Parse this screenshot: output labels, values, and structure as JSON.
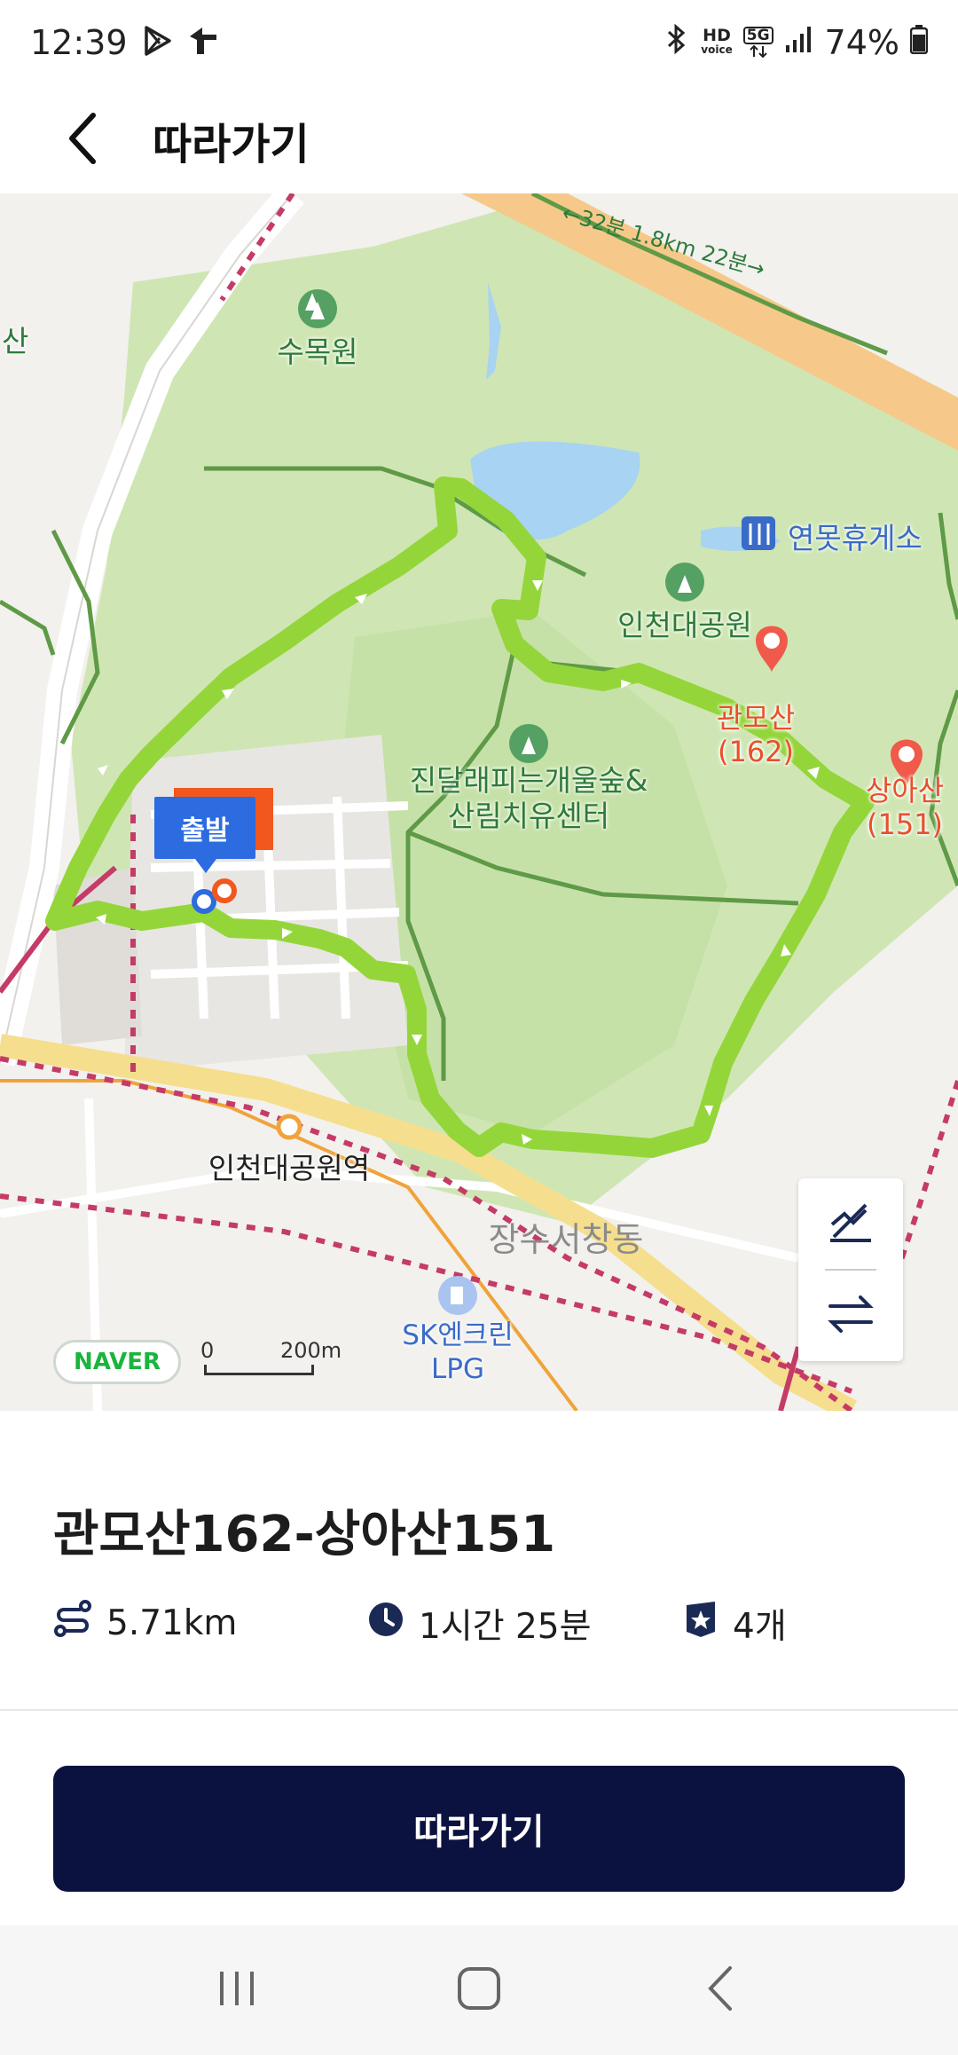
{
  "status_bar": {
    "time": "12:39",
    "hd_voice_top": "HD",
    "hd_voice_bottom": "voice",
    "net_5g": "5G",
    "battery_percent": "74%",
    "icons": [
      "play-store-icon",
      "app-notification-icon",
      "bluetooth-icon",
      "signal-icon",
      "battery-icon"
    ]
  },
  "header": {
    "title": "따라가기",
    "back_icon": "chevron-left-icon"
  },
  "map": {
    "labels": {
      "arboretum": "수목원",
      "park": "인천대공원",
      "rest_area": "연못휴게소",
      "forest_center_line1": "진달래피는개울숲&",
      "forest_center_line2": "산림치유센터",
      "peak1_name": "관모산",
      "peak1_height": "(162)",
      "peak2_name": "상아산",
      "peak2_height": "(151)",
      "station": "인천대공원역",
      "district": "장수서창동",
      "gas_line1": "SK엔크린",
      "gas_line2": "LPG",
      "left_edge": "산",
      "road_info": "←32분 1.8km 22분→"
    },
    "start_marker": "출발",
    "naver_logo": "NAVER",
    "scale_zero": "0",
    "scale_distance": "200m",
    "route_color": "#94d63a",
    "controls": [
      "elevation-toggle-icon",
      "reverse-route-icon"
    ]
  },
  "course": {
    "title": "관모산162-상아산151",
    "distance": "5.71km",
    "duration": "1시간 25분",
    "peaks_count": "4개"
  },
  "action": {
    "follow_label": "따라가기"
  },
  "colors": {
    "primary_navy": "#0b1240",
    "accent_orange": "#e8502a",
    "start_blue": "#2c6be0"
  }
}
